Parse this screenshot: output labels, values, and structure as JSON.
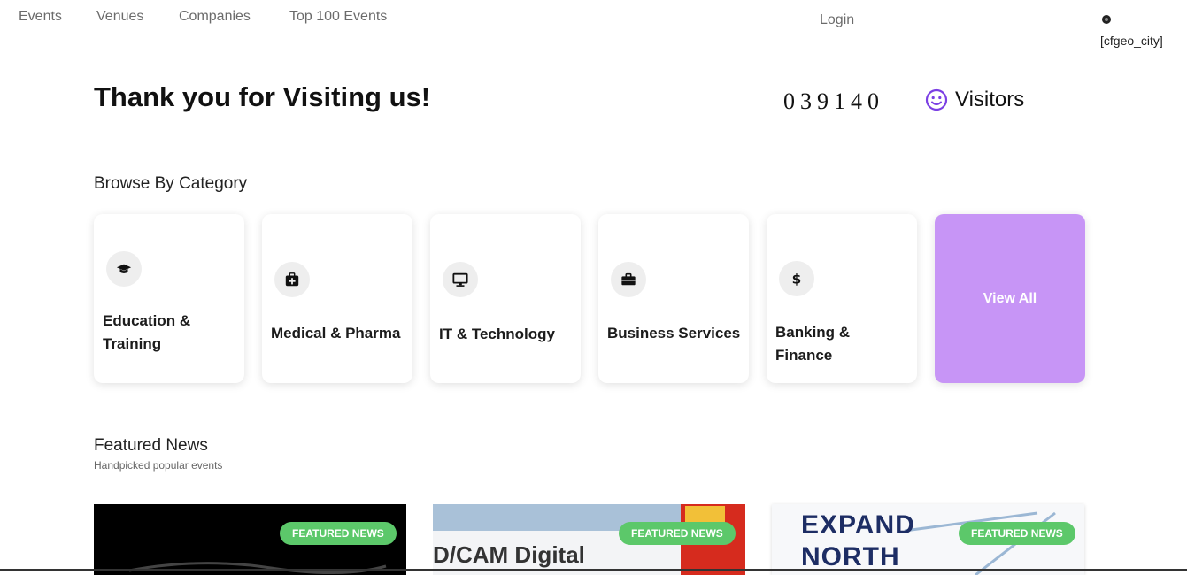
{
  "nav": {
    "items": [
      {
        "label": "Events"
      },
      {
        "label": "Venues"
      },
      {
        "label": "Companies"
      },
      {
        "label": "Top 100 Events"
      }
    ],
    "login": "Login",
    "geo_text": "[cfgeo_city]"
  },
  "hero": {
    "title": "Thank you for Visiting us!",
    "counter": "039140",
    "visitors_label": "Visitors",
    "accent_color": "#7b3fe4"
  },
  "categories": {
    "title": "Browse By Category",
    "items": [
      {
        "label": "Education & Training",
        "icon": "graduation-cap-icon"
      },
      {
        "label": "Medical & Pharma",
        "icon": "medical-kit-icon"
      },
      {
        "label": "IT & Technology",
        "icon": "monitor-icon"
      },
      {
        "label": "Business Services",
        "icon": "briefcase-icon"
      },
      {
        "label": "Banking & Finance",
        "icon": "dollar-icon"
      }
    ],
    "view_all": "View All",
    "view_all_color": "#c795f6"
  },
  "featured": {
    "title": "Featured News",
    "subtitle": "Handpicked popular events",
    "badge_color": "#5cc86a",
    "cards": [
      {
        "badge": "FEATURED NEWS",
        "image_text": ""
      },
      {
        "badge": "FEATURED NEWS",
        "image_text": "D/CAM Digital"
      },
      {
        "badge": "FEATURED NEWS",
        "image_text": "EXPAND NORTH"
      }
    ]
  }
}
